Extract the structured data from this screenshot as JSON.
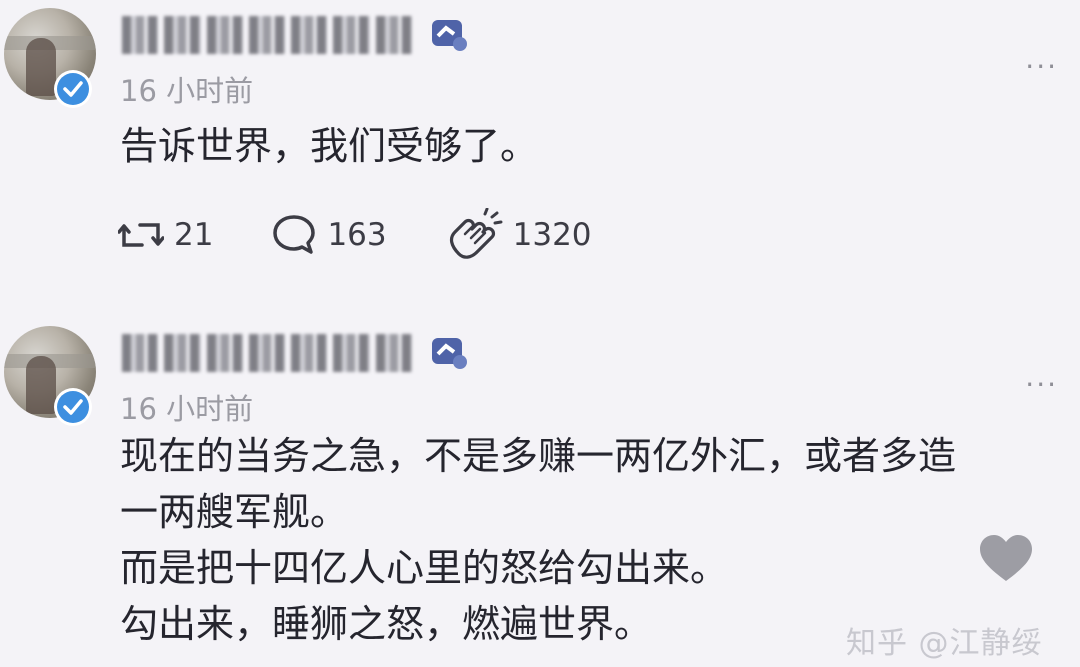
{
  "posts": [
    {
      "time": "16 小时前",
      "content": "告诉世界，我们受够了。",
      "more_label": "···",
      "actions": {
        "repost_count": "21",
        "comment_count": "163",
        "like_count": "1320"
      }
    },
    {
      "time": "16 小时前",
      "content": "现在的当务之急，不是多赚一两亿外汇，或者多造\n一两艘军舰。\n而是把十四亿人心里的怒给勾出来。\n勾出来，睡狮之怒，燃遍世界。",
      "more_label": "···"
    }
  ],
  "watermark": "知乎 @江静绥",
  "colors": {
    "verified": "#3d8fe0",
    "text": "#25252e",
    "muted": "#9b9ba3",
    "background": "#f4f3f7"
  },
  "icons": [
    "verified-icon",
    "badge-icon",
    "more-icon",
    "repost-icon",
    "comment-icon",
    "clap-icon",
    "heart-icon"
  ]
}
